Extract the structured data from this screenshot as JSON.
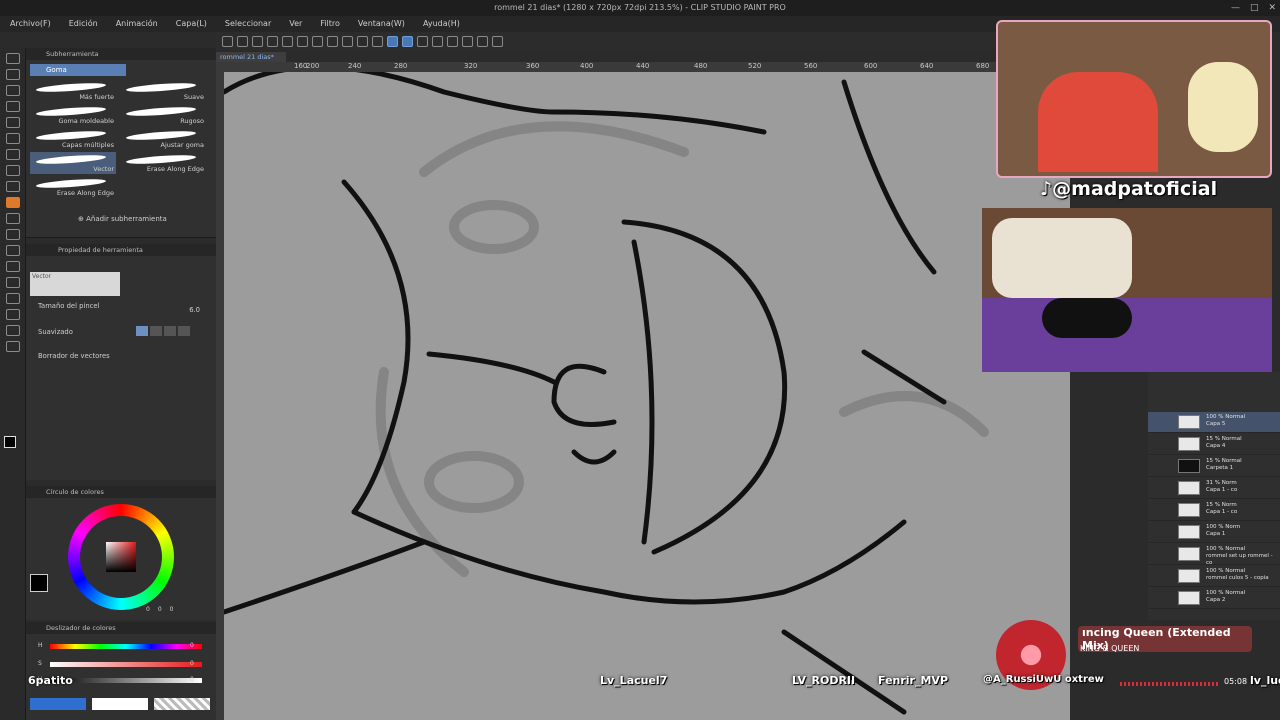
{
  "window": {
    "title": "rommel 21 dias* (1280 x 720px 72dpi 213.5%) - CLIP STUDIO PAINT PRO",
    "minimize": "—",
    "maximize": "□",
    "close": "✕"
  },
  "menu": [
    "Archivo(F)",
    "Edición",
    "Animación",
    "Capa(L)",
    "Seleccionar",
    "Ver",
    "Filtro",
    "Ventana(W)",
    "Ayuda(H)"
  ],
  "canvas_tab": "rommel 21 dias*",
  "ruler": [
    "160",
    "200",
    "240",
    "280",
    "320",
    "360",
    "400",
    "440",
    "480",
    "520",
    "560",
    "600",
    "640",
    "680"
  ],
  "subtool": {
    "panel_title": "Subherramienta",
    "group": "Goma",
    "brushes": [
      "Más fuerte",
      "Suave",
      "Goma moldeable",
      "Rugoso",
      "Capas múltiples",
      "Ajustar goma",
      "Vector",
      "Erase Along Edge",
      "Erase Along Edge"
    ],
    "add_label": "Añadir subherramienta"
  },
  "tool_property": {
    "panel_title": "Propiedad de herramienta",
    "preview_label": "Vector",
    "brush_size_label": "Tamaño del pincel",
    "brush_size_value": "6.0",
    "smoothing_label": "Suavizado",
    "vector_eraser_label": "Borrador de vectores"
  },
  "color_panel": {
    "title": "Círculo de colores",
    "fg_color": "#000000",
    "values": [
      "0",
      "0",
      "0"
    ]
  },
  "color_sliders": {
    "title": "Deslizador de colores",
    "h_label": "H",
    "s_label": "S",
    "v_label": "V",
    "h_value": "0",
    "s_value": "0",
    "v_value": "0"
  },
  "overlay": {
    "handle": "@madpatoficial",
    "music_title": "ıncing Queen (Extended Mix)",
    "music_artist": "KING & QUEEN",
    "music_time": "05:08",
    "chat_names": [
      "Lv_Lacuel7",
      "LV_RODRII",
      "Fenrir_MVP",
      "@A_RussiUwU oxtrew",
      "lv_luc"
    ],
    "status_left": "6patito"
  },
  "layers": [
    {
      "mode": "100 % Normal",
      "name": "Capa 5"
    },
    {
      "mode": "15 % Normal",
      "name": "Capa 4"
    },
    {
      "mode": "15 % Normal",
      "name": "Carpeta 1"
    },
    {
      "mode": "31 % Norm",
      "name": "Capa 1 - co"
    },
    {
      "mode": "15 % Norm",
      "name": "Capa 1 - co"
    },
    {
      "mode": "100 % Norm",
      "name": "Capa 1"
    },
    {
      "mode": "100 % Normal",
      "name": "rommel set up rommel - co"
    },
    {
      "mode": "100 % Normal",
      "name": "rommel culos 5 - copia"
    },
    {
      "mode": "100 % Normal",
      "name": "Capa 2"
    }
  ],
  "colors": {
    "accent": "#5a7fb5",
    "active_tool": "#e07a2a",
    "canvas_bg": "#9c9c9c",
    "webcam_border": "#e7a7c3"
  }
}
